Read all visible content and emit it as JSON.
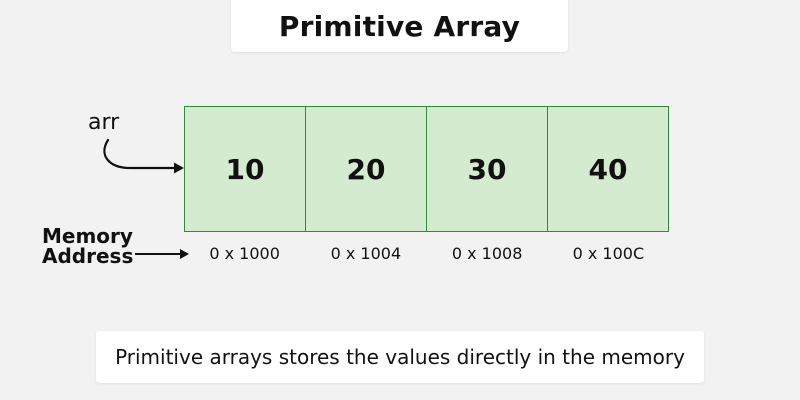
{
  "title": "Primitive Array",
  "pointer_label": "arr",
  "memory_label": {
    "line1": "Memory",
    "line2": "Address"
  },
  "cells": [
    "10",
    "20",
    "30",
    "40"
  ],
  "addresses": [
    "0 x 1000",
    "0 x 1004",
    "0 x 1008",
    "0 x 100C"
  ],
  "caption": "Primitive arrays stores the values directly in the memory",
  "colors": {
    "cell_fill": "#d4ebcf",
    "cell_border": "#2e8b3a",
    "background": "#f2f2f2"
  },
  "icons": [
    "curved-arrow-icon",
    "right-arrow-icon"
  ]
}
